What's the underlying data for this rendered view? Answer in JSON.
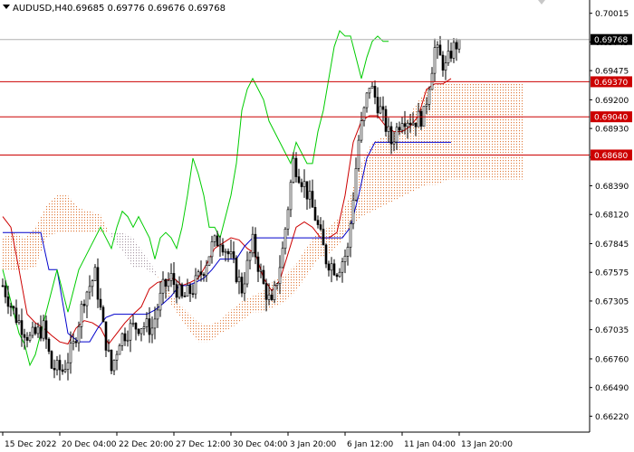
{
  "header": {
    "symbol": "AUDUSD,H4",
    "ohlc": "0.69685 0.69776 0.69676 0.69768"
  },
  "colors": {
    "background": "#ffffff",
    "candle": "#000000",
    "tenkan": "#cc0000",
    "kijun": "#0000cc",
    "chikou": "#00cc00",
    "kumo_bull": "#e07a3a",
    "kumo_bear": "#a89aa6",
    "level_line": "#cc0000",
    "price_line": "#b0b0b0"
  },
  "chart_data": {
    "type": "candlestick",
    "title": "",
    "xlabel": "",
    "ylabel": "",
    "ylim": [
      0.6607,
      0.7014
    ],
    "y_ticks": [
      "0.70015",
      "0.69745",
      "0.69475",
      "0.69200",
      "0.68930",
      "0.68660",
      "0.68390",
      "0.68120",
      "0.67845",
      "0.67575",
      "0.67305",
      "0.67035",
      "0.66760",
      "0.66490",
      "0.66220"
    ],
    "x_ticks": [
      "15 Dec 2022",
      "20 Dec 04:00",
      "22 Dec 20:00",
      "27 Dec 12:00",
      "30 Dec 04:00",
      "3 Jan 20:00",
      "6 Jan 12:00",
      "11 Jan 04:00",
      "13 Jan 20:00"
    ],
    "current_price": {
      "value": 0.69768,
      "label": "0.69768"
    },
    "levels": [
      {
        "value": 0.6937,
        "label": "0.69370"
      },
      {
        "value": 0.6904,
        "label": "0.69040"
      },
      {
        "value": 0.6868,
        "label": "0.68680"
      }
    ],
    "price_path": [
      {
        "x": 0,
        "y": 0.6745
      },
      {
        "x": 5,
        "y": 0.6715
      },
      {
        "x": 10,
        "y": 0.6695
      },
      {
        "x": 15,
        "y": 0.6705
      },
      {
        "x": 18,
        "y": 0.6668
      },
      {
        "x": 22,
        "y": 0.6665
      },
      {
        "x": 26,
        "y": 0.6688
      },
      {
        "x": 30,
        "y": 0.6735
      },
      {
        "x": 34,
        "y": 0.6755
      },
      {
        "x": 37,
        "y": 0.6705
      },
      {
        "x": 40,
        "y": 0.6665
      },
      {
        "x": 43,
        "y": 0.6695
      },
      {
        "x": 47,
        "y": 0.6705
      },
      {
        "x": 51,
        "y": 0.6708
      },
      {
        "x": 55,
        "y": 0.6705
      },
      {
        "x": 59,
        "y": 0.6742
      },
      {
        "x": 62,
        "y": 0.6752
      },
      {
        "x": 66,
        "y": 0.6732
      },
      {
        "x": 70,
        "y": 0.6742
      },
      {
        "x": 74,
        "y": 0.6762
      },
      {
        "x": 77,
        "y": 0.6782
      },
      {
        "x": 80,
        "y": 0.679
      },
      {
        "x": 84,
        "y": 0.677
      },
      {
        "x": 88,
        "y": 0.6742
      },
      {
        "x": 92,
        "y": 0.6785
      },
      {
        "x": 96,
        "y": 0.6745
      },
      {
        "x": 99,
        "y": 0.6725
      },
      {
        "x": 103,
        "y": 0.6778
      },
      {
        "x": 107,
        "y": 0.6862
      },
      {
        "x": 111,
        "y": 0.684
      },
      {
        "x": 115,
        "y": 0.681
      },
      {
        "x": 119,
        "y": 0.677
      },
      {
        "x": 123,
        "y": 0.676
      },
      {
        "x": 127,
        "y": 0.6778
      },
      {
        "x": 131,
        "y": 0.6882
      },
      {
        "x": 135,
        "y": 0.6935
      },
      {
        "x": 139,
        "y": 0.691
      },
      {
        "x": 143,
        "y": 0.688
      },
      {
        "x": 147,
        "y": 0.6905
      },
      {
        "x": 151,
        "y": 0.69
      },
      {
        "x": 155,
        "y": 0.6905
      },
      {
        "x": 159,
        "y": 0.6968
      },
      {
        "x": 163,
        "y": 0.695
      },
      {
        "x": 165,
        "y": 0.6965
      },
      {
        "x": 168,
        "y": 0.6976
      }
    ],
    "series": [
      {
        "role": "tenkan",
        "x": [
          0,
          3,
          6,
          9,
          12,
          15,
          18,
          21,
          24,
          27,
          30,
          33,
          36,
          39,
          42,
          45,
          48,
          51,
          54,
          57,
          60,
          63,
          66,
          69,
          72,
          75,
          78,
          81,
          84,
          87,
          90,
          93,
          96,
          99,
          102,
          105,
          108,
          111,
          114,
          117,
          120,
          123,
          126,
          129,
          132,
          135,
          138,
          141,
          144,
          147,
          150,
          153,
          156,
          159,
          162,
          165
        ],
        "y": [
          0.681,
          0.68,
          0.676,
          0.6718,
          0.671,
          0.6705,
          0.6698,
          0.6692,
          0.669,
          0.6705,
          0.6712,
          0.671,
          0.6705,
          0.669,
          0.67,
          0.671,
          0.6718,
          0.6725,
          0.6742,
          0.6748,
          0.675,
          0.6752,
          0.6745,
          0.6748,
          0.6752,
          0.6765,
          0.678,
          0.6785,
          0.679,
          0.6788,
          0.678,
          0.6775,
          0.6752,
          0.674,
          0.675,
          0.6775,
          0.68,
          0.6805,
          0.68,
          0.679,
          0.679,
          0.6795,
          0.683,
          0.688,
          0.69,
          0.6905,
          0.6905,
          0.6895,
          0.689,
          0.689,
          0.6895,
          0.6905,
          0.693,
          0.6935,
          0.6935,
          0.694
        ]
      },
      {
        "role": "kijun",
        "x": [
          0,
          5,
          10,
          14,
          17,
          20,
          24,
          28,
          32,
          35,
          38,
          41,
          44,
          47,
          50,
          53,
          56,
          59,
          62,
          65,
          68,
          71,
          74,
          77,
          80,
          83,
          86,
          89,
          92,
          95,
          98,
          101,
          104,
          107,
          110,
          113,
          116,
          119,
          122,
          125,
          128,
          131,
          134,
          137,
          140,
          143,
          146,
          149,
          152,
          155,
          158,
          161,
          165
        ],
        "y": [
          0.6795,
          0.6795,
          0.6795,
          0.6795,
          0.676,
          0.676,
          0.67,
          0.6692,
          0.6692,
          0.6705,
          0.6715,
          0.6718,
          0.6718,
          0.6718,
          0.6718,
          0.6718,
          0.6722,
          0.6728,
          0.6735,
          0.6745,
          0.6745,
          0.6748,
          0.6752,
          0.676,
          0.677,
          0.677,
          0.677,
          0.6782,
          0.679,
          0.679,
          0.679,
          0.679,
          0.679,
          0.679,
          0.679,
          0.679,
          0.679,
          0.679,
          0.679,
          0.679,
          0.68,
          0.683,
          0.6865,
          0.688,
          0.688,
          0.688,
          0.688,
          0.688,
          0.688,
          0.688,
          0.688,
          0.688,
          0.688
        ]
      },
      {
        "role": "chikou",
        "x": [
          0,
          2,
          4,
          6,
          8,
          10,
          12,
          14,
          16,
          18,
          20,
          22,
          24,
          26,
          28,
          30,
          32,
          34,
          36,
          38,
          40,
          42,
          44,
          46,
          48,
          50,
          52,
          54,
          56,
          58,
          60,
          62,
          64,
          66,
          68,
          70,
          72,
          74,
          76,
          78,
          80,
          82,
          84,
          86,
          88,
          90,
          92,
          94,
          96,
          98,
          100,
          102,
          104,
          106,
          108,
          110,
          112,
          114,
          116,
          118,
          120,
          122,
          124,
          126,
          128,
          130,
          132,
          134,
          136,
          138,
          140,
          142
        ],
        "y": [
          0.676,
          0.674,
          0.672,
          0.67,
          0.669,
          0.667,
          0.668,
          0.67,
          0.672,
          0.674,
          0.676,
          0.674,
          0.672,
          0.674,
          0.676,
          0.677,
          0.678,
          0.679,
          0.68,
          0.679,
          0.678,
          0.68,
          0.6815,
          0.681,
          0.68,
          0.681,
          0.68,
          0.679,
          0.677,
          0.679,
          0.6795,
          0.679,
          0.678,
          0.68,
          0.683,
          0.6865,
          0.685,
          0.683,
          0.68,
          0.68,
          0.679,
          0.681,
          0.683,
          0.686,
          0.691,
          0.693,
          0.694,
          0.693,
          0.692,
          0.69,
          0.689,
          0.688,
          0.687,
          0.686,
          0.688,
          0.687,
          0.686,
          0.686,
          0.689,
          0.691,
          0.694,
          0.697,
          0.6985,
          0.698,
          0.698,
          0.696,
          0.694,
          0.696,
          0.6975,
          0.698,
          0.6975,
          0.6975
        ]
      },
      {
        "role": "senkou_a",
        "x": [
          0,
          4,
          8,
          12,
          16,
          20,
          24,
          28,
          32,
          36,
          40,
          44,
          48,
          52,
          56,
          60,
          64,
          68,
          72,
          76,
          80,
          84,
          88,
          92,
          96,
          100,
          104,
          108,
          112,
          116,
          120,
          124,
          128,
          132,
          136,
          140,
          144,
          148,
          152,
          156,
          160,
          164,
          168,
          172,
          176,
          180,
          184,
          188,
          192
        ],
        "y": [
          0.679,
          0.6795,
          0.679,
          0.68,
          0.682,
          0.683,
          0.683,
          0.6818,
          0.6815,
          0.6812,
          0.679,
          0.6778,
          0.6762,
          0.6762,
          0.6755,
          0.6745,
          0.673,
          0.672,
          0.671,
          0.6708,
          0.6712,
          0.6722,
          0.673,
          0.6735,
          0.674,
          0.675,
          0.6755,
          0.6765,
          0.6782,
          0.6795,
          0.68,
          0.681,
          0.683,
          0.686,
          0.688,
          0.6885,
          0.689,
          0.69,
          0.6915,
          0.693,
          0.6935,
          0.6935,
          0.6935,
          0.6935,
          0.6935,
          0.6935,
          0.6935,
          0.6935,
          0.6935
        ]
      },
      {
        "role": "senkou_b",
        "x": [
          0,
          4,
          8,
          12,
          16,
          20,
          24,
          28,
          32,
          36,
          40,
          44,
          48,
          52,
          56,
          60,
          64,
          68,
          72,
          76,
          80,
          84,
          88,
          92,
          96,
          100,
          104,
          108,
          112,
          116,
          120,
          124,
          128,
          132,
          136,
          140,
          144,
          148,
          152,
          156,
          160,
          164,
          168,
          172,
          176,
          180,
          184,
          188,
          192
        ],
        "y": [
          0.676,
          0.676,
          0.676,
          0.6762,
          0.679,
          0.6795,
          0.6795,
          0.6795,
          0.6795,
          0.6795,
          0.6795,
          0.6795,
          0.679,
          0.6775,
          0.676,
          0.6735,
          0.672,
          0.6705,
          0.6692,
          0.6692,
          0.67,
          0.6705,
          0.6712,
          0.672,
          0.672,
          0.6725,
          0.673,
          0.674,
          0.6755,
          0.677,
          0.6775,
          0.6785,
          0.68,
          0.681,
          0.6815,
          0.682,
          0.6825,
          0.683,
          0.6835,
          0.684,
          0.684,
          0.6845,
          0.6845,
          0.6845,
          0.6845,
          0.6845,
          0.6845,
          0.6845,
          0.6845
        ]
      }
    ]
  }
}
